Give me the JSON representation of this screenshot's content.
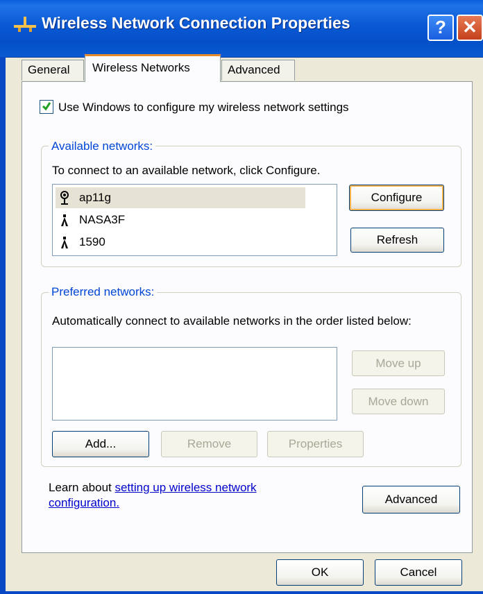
{
  "window": {
    "title": "Wireless Network Connection Properties",
    "help_label": "?",
    "close_label": "✕"
  },
  "tabs": [
    {
      "label": "General",
      "active": false
    },
    {
      "label": "Wireless Networks",
      "active": true
    },
    {
      "label": "Advanced",
      "active": false
    }
  ],
  "use_windows": {
    "label": "Use Windows to configure my wireless network settings",
    "checked": true
  },
  "available": {
    "title": "Available networks:",
    "description": "To connect to an available network, click Configure.",
    "networks": [
      {
        "name": "ap11g",
        "icon": "connected-antenna-icon",
        "selected": true
      },
      {
        "name": "NASA3F",
        "icon": "antenna-icon",
        "selected": false
      },
      {
        "name": "1590",
        "icon": "antenna-icon",
        "selected": false
      }
    ],
    "configure_label": "Configure",
    "refresh_label": "Refresh"
  },
  "preferred": {
    "title": "Preferred networks:",
    "description": "Automatically connect to available networks in the order listed below:",
    "move_up_label": "Move up",
    "move_down_label": "Move down",
    "add_label": "Add...",
    "remove_label": "Remove",
    "properties_label": "Properties"
  },
  "learn": {
    "prefix": "Learn about ",
    "link_text": "setting up wireless network configuration."
  },
  "advanced_button_label": "Advanced",
  "ok_label": "OK",
  "cancel_label": "Cancel",
  "colors": {
    "titlebar": "#0a58d4",
    "dialog_bg": "#ece9d8",
    "group_title": "#0046d5",
    "active_tab_accent": "#e68b2c"
  }
}
